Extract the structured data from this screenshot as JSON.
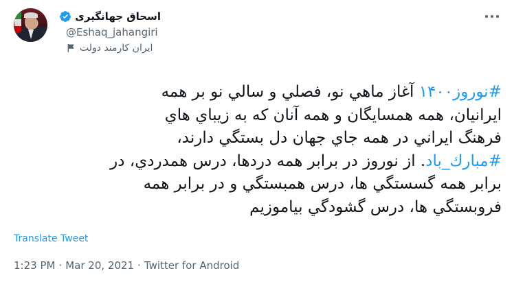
{
  "author": {
    "display_name": "اسحاق جهانگیری",
    "handle": "@Eshaq_jahangiri",
    "label": "ایران کارمند دولت",
    "verified": true,
    "avatar_icon": "avatar-photo",
    "label_icon": "flag-icon"
  },
  "more_icon": "more-options-icon",
  "tweet": {
    "line1_hashtag": "#نوروز۱۴۰۰",
    "line1_rest": " آغاز  ماهي نو، فصلي و سالي نو بر همه",
    "line2": "ايرانيان، همه همسايگان و همه آنان كه به زيباي هاي",
    "line3": "فرهنگ ايراني در همه جاي جهان دل بستگي دارند،",
    "line4_hashtag": "#مبارك_باد",
    "line4_rest": ". از نوروز در برابر همه دردها، درس همدردي، در",
    "line5": "برابر همه گسستگي ها، درس همبستگي و در برابر همه",
    "line6": "فروبستگي ها، درس گشودگي بياموزيم"
  },
  "translate_label": "Translate Tweet",
  "meta": {
    "time": "1:23 PM",
    "date": "Mar 20, 2021",
    "source": "Twitter for Android",
    "separator": "·"
  },
  "colors": {
    "accent": "#1d9bf0",
    "text": "#0f1419",
    "secondary": "#536471"
  }
}
